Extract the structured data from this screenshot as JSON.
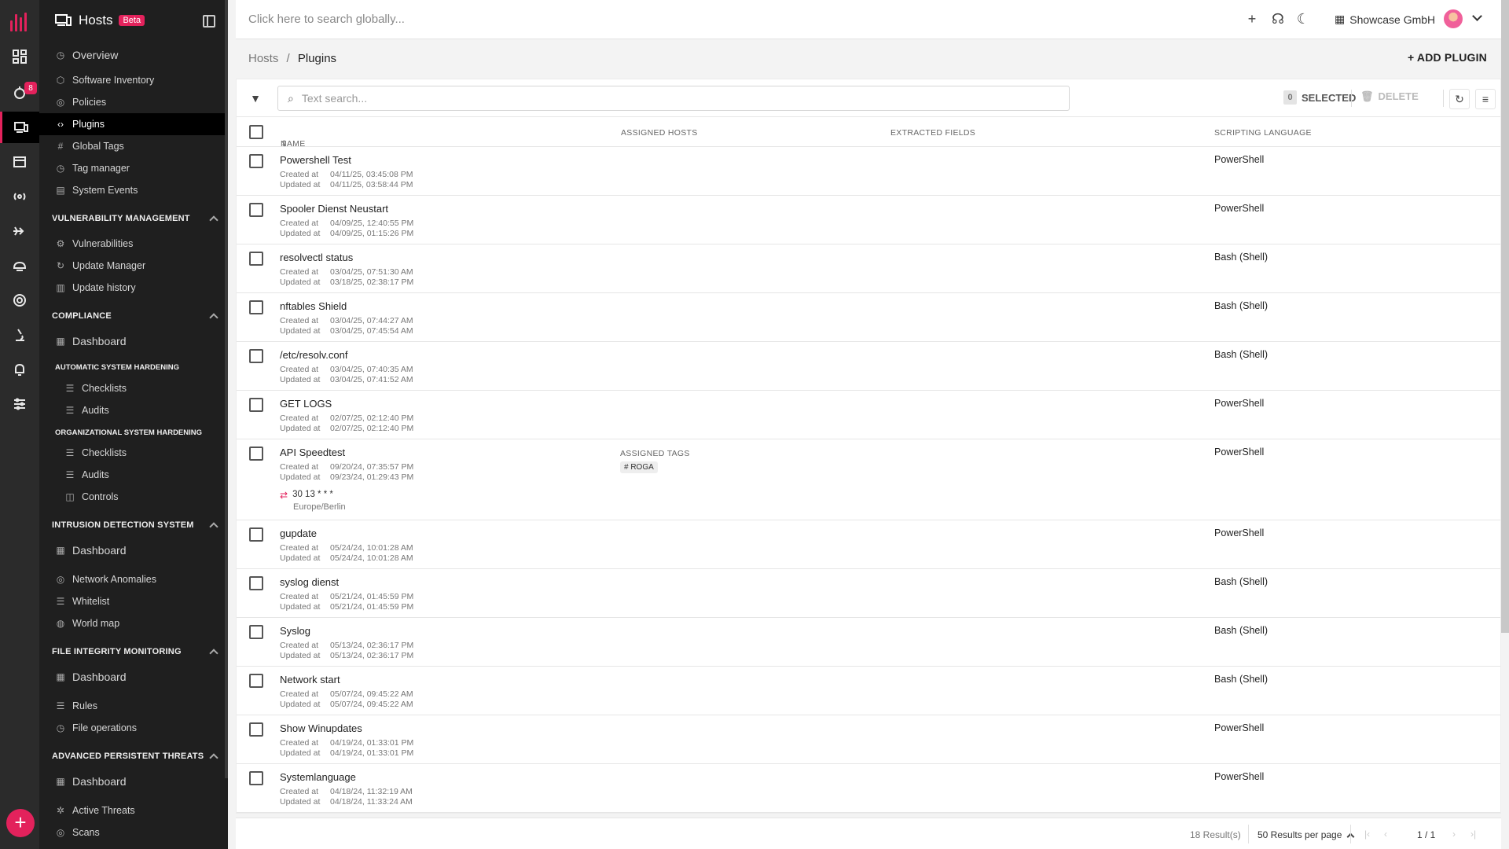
{
  "app": {
    "section_title": "Hosts",
    "beta_label": "Beta",
    "notification_count": "8"
  },
  "topbar": {
    "search_placeholder": "Click here to search globally...",
    "company": "Showcase GmbH"
  },
  "sidebar": {
    "top_items": [
      {
        "label": "Overview",
        "icon": "clock-icon"
      },
      {
        "label": "Software Inventory",
        "icon": "box-icon"
      },
      {
        "label": "Policies",
        "icon": "target-icon"
      },
      {
        "label": "Plugins",
        "icon": "code-icon"
      },
      {
        "label": "Global Tags",
        "icon": "hash-icon"
      },
      {
        "label": "Tag manager",
        "icon": "clock-icon"
      },
      {
        "label": "System Events",
        "icon": "list-icon"
      }
    ],
    "vuln": {
      "title": "VULNERABILITY MANAGEMENT",
      "items": [
        "Vulnerabilities",
        "Update Manager",
        "Update history"
      ]
    },
    "compliance": {
      "title": "COMPLIANCE",
      "dashboard": "Dashboard",
      "auto_title": "AUTOMATIC SYSTEM HARDENING",
      "auto_items": [
        "Checklists",
        "Audits"
      ],
      "org_title": "ORGANIZATIONAL SYSTEM HARDENING",
      "org_items": [
        "Checklists",
        "Audits",
        "Controls"
      ]
    },
    "ids": {
      "title": "INTRUSION DETECTION SYSTEM",
      "dashboard": "Dashboard",
      "items": [
        "Network Anomalies",
        "Whitelist",
        "World map"
      ]
    },
    "fim": {
      "title": "FILE INTEGRITY MONITORING",
      "dashboard": "Dashboard",
      "items": [
        "Rules",
        "File operations"
      ]
    },
    "apt": {
      "title": "ADVANCED PERSISTENT THREATS",
      "dashboard": "Dashboard",
      "items": [
        "Active Threats",
        "Scans"
      ]
    }
  },
  "breadcrumb": {
    "parent": "Hosts",
    "separator": "/",
    "current": "Plugins"
  },
  "actions": {
    "add_plugin": "+ ADD PLUGIN"
  },
  "toolbar": {
    "search_placeholder": "Text search...",
    "selected_count": "0",
    "selected_label": "SELECTED",
    "delete_label": "DELETE"
  },
  "table": {
    "columns": {
      "name": "NAME",
      "assigned_hosts": "ASSIGNED HOSTS",
      "extracted_fields": "EXTRACTED FIELDS",
      "scripting_language": "SCRIPTING LANGUAGE"
    },
    "created_label": "Created at",
    "updated_label": "Updated at",
    "rows": [
      {
        "name": "Powershell Test",
        "created": "04/11/25, 03:45:08 PM",
        "updated": "04/11/25, 03:58:44 PM",
        "lang": "PowerShell"
      },
      {
        "name": "Spooler Dienst Neustart",
        "created": "04/09/25, 12:40:55 PM",
        "updated": "04/09/25, 01:15:26 PM",
        "lang": "PowerShell"
      },
      {
        "name": "resolvectl status",
        "created": "03/04/25, 07:51:30 AM",
        "updated": "03/18/25, 02:38:17 PM",
        "lang": "Bash (Shell)"
      },
      {
        "name": "nftables Shield",
        "created": "03/04/25, 07:44:27 AM",
        "updated": "03/04/25, 07:45:54 AM",
        "lang": "Bash (Shell)"
      },
      {
        "name": "/etc/resolv.conf",
        "created": "03/04/25, 07:40:35 AM",
        "updated": "03/04/25, 07:41:52 AM",
        "lang": "Bash (Shell)"
      },
      {
        "name": "GET LOGS",
        "created": "02/07/25, 02:12:40 PM",
        "updated": "02/07/25, 02:12:40 PM",
        "lang": "PowerShell"
      },
      {
        "name": "API Speedtest",
        "created": "09/20/24, 07:35:57 PM",
        "updated": "09/23/24, 01:29:43 PM",
        "lang": "PowerShell",
        "tags_label": "ASSIGNED TAGS",
        "tag": "# ROGA",
        "cron": "30 13 * * *",
        "timezone": "Europe/Berlin"
      },
      {
        "name": "gupdate",
        "created": "05/24/24, 10:01:28 AM",
        "updated": "05/24/24, 10:01:28 AM",
        "lang": "PowerShell"
      },
      {
        "name": "syslog dienst",
        "created": "05/21/24, 01:45:59 PM",
        "updated": "05/21/24, 01:45:59 PM",
        "lang": "Bash (Shell)"
      },
      {
        "name": "Syslog",
        "created": "05/13/24, 02:36:17 PM",
        "updated": "05/13/24, 02:36:17 PM",
        "lang": "Bash (Shell)"
      },
      {
        "name": "Network start",
        "created": "05/07/24, 09:45:22 AM",
        "updated": "05/07/24, 09:45:22 AM",
        "lang": "Bash (Shell)"
      },
      {
        "name": "Show Winupdates",
        "created": "04/19/24, 01:33:01 PM",
        "updated": "04/19/24, 01:33:01 PM",
        "lang": "PowerShell"
      },
      {
        "name": "Systemlanguage",
        "created": "04/18/24, 11:32:19 AM",
        "updated": "04/18/24, 11:33:24 AM",
        "lang": "PowerShell"
      }
    ]
  },
  "footer": {
    "results": "18 Result(s)",
    "per_page": "50 Results per page",
    "pages": "1 / 1"
  },
  "colors": {
    "accent": "#e3225c",
    "sidebar_bg": "#1f1f1f",
    "rail_bg": "#2b2b2b"
  }
}
